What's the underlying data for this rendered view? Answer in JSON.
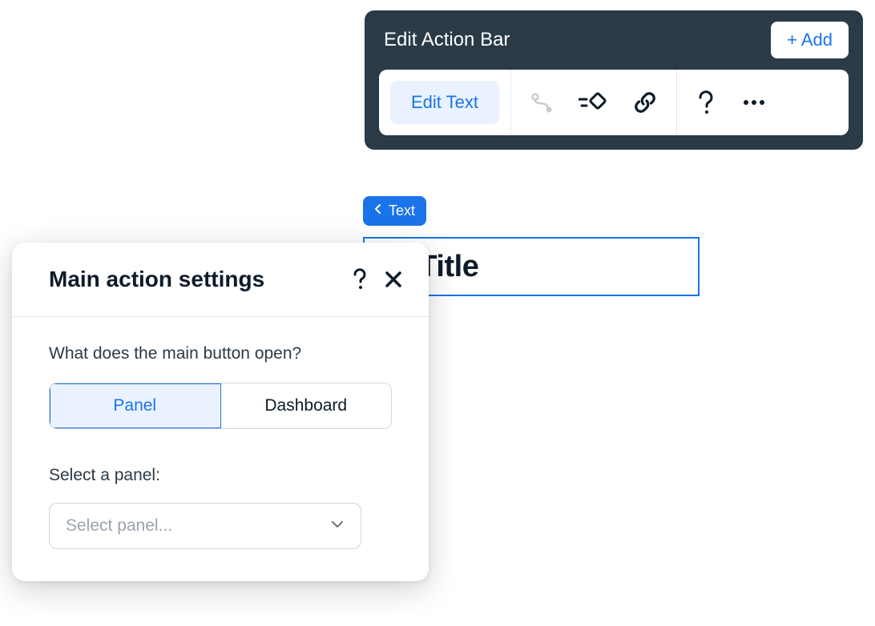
{
  "actionBar": {
    "title": "Edit Action Bar",
    "addButton": "+ Add",
    "editTextButton": "Edit Text"
  },
  "textChip": {
    "label": "Text"
  },
  "titleBox": {
    "text": "ox Title"
  },
  "settings": {
    "title": "Main action settings",
    "question": "What does the main button open?",
    "options": {
      "panel": "Panel",
      "dashboard": "Dashboard"
    },
    "selectLabel": "Select a panel:",
    "selectPlaceholder": "Select panel..."
  }
}
